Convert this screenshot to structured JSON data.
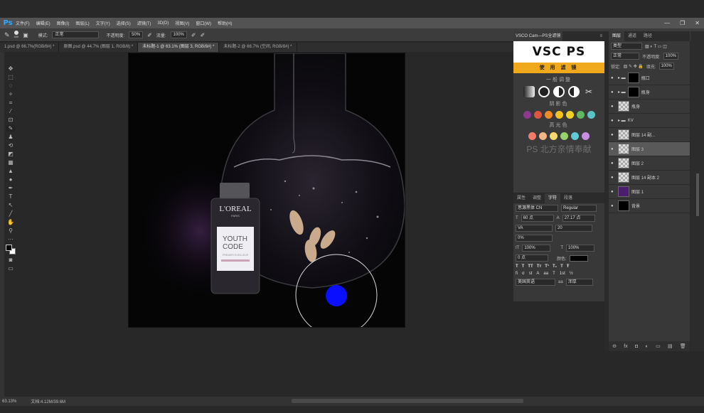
{
  "app": {
    "logo": "Ps",
    "menus": [
      "文件(F)",
      "编辑(E)",
      "图像(I)",
      "图层(L)",
      "文字(Y)",
      "选择(S)",
      "滤镜(T)",
      "3D(D)",
      "视图(V)",
      "窗口(W)",
      "帮助(H)"
    ],
    "window_controls": [
      "—",
      "❐",
      "✕"
    ]
  },
  "options": {
    "brush_size": "400",
    "mode_label": "模式:",
    "mode_value": "正常",
    "opacity_label": "不透明度:",
    "opacity_value": "50%",
    "flow_label": "流量:",
    "flow_value": "100%"
  },
  "tabs": [
    "1.psd @ 66.7%(RGB/8#) *",
    "原图.psd @ 44.7% (图层 1, RGB/8) *",
    "未标题-1 @ 63.1% (图层 3, RGB/8#) *",
    "未标题-2 @ 66.7% (空间, RGB/8#) *"
  ],
  "status": {
    "zoom": "63.13%",
    "doc": "文档:4.12M/39.6M"
  },
  "canvas": {
    "brand": "L'OREAL",
    "brand_sub": "PARIS",
    "product_line1": "YOUTH",
    "product_line2": "CODE",
    "product_sub": "PREMIER EVEILLEUR",
    "colors": {
      "brush_dot": "#0a10ff"
    }
  },
  "vsco": {
    "tab_title": "VSCO Cam—PS全滤镜",
    "logo": "VSC  PS",
    "band": "使 用 滤 镜",
    "sec_general": "一般调整",
    "sec_shadow": "阴影色",
    "sec_highlight": "高光色",
    "footer": "PS 北方亲情奉献",
    "shadow_colors": [
      "#8b3a8f",
      "#e0533c",
      "#f08a25",
      "#f5c21b",
      "#f2d02a",
      "#5fb85a",
      "#5ac4c4"
    ],
    "highlight_colors": [
      "#f27c6a",
      "#f5b486",
      "#f9d86b",
      "#96d46b",
      "#5fcbd6",
      "#c58ee0"
    ]
  },
  "character": {
    "tabs": [
      "属性",
      "调整",
      "字符",
      "段落"
    ],
    "font": "思源黑体 CN",
    "style": "Regular",
    "size": "60 点",
    "leading": "27.17 点",
    "kerning": "VA",
    "tracking": "20",
    "scale_pct": "0%",
    "vscale": "100%",
    "hscale": "100%",
    "baseline": "0 点",
    "color_label": "颜色:",
    "lang": "美国英语",
    "aa": "浑厚",
    "styles": [
      "T",
      "T",
      "TT",
      "Tт",
      "T¹",
      "T₁",
      "T",
      "Ŧ"
    ],
    "ot": [
      "fi",
      "σ",
      "st",
      "A",
      "aa",
      "T",
      "1st",
      "½"
    ]
  },
  "layers": {
    "tabs": [
      "图层",
      "通道",
      "路径"
    ],
    "kind": "类型",
    "blend": "正常",
    "opacity_label": "不透明度:",
    "opacity": "100%",
    "lock_label": "锁定:",
    "fill_label": "填充:",
    "fill": "100%",
    "rows": [
      {
        "name": "瓶口",
        "type": "group"
      },
      {
        "name": "瓶身",
        "type": "group"
      },
      {
        "name": "瓶身",
        "type": "layer"
      },
      {
        "name": "KV",
        "type": "group"
      },
      {
        "name": "图层 14 副...",
        "type": "layer"
      },
      {
        "name": "图层 3",
        "type": "layer",
        "selected": true
      },
      {
        "name": "图层 2",
        "type": "layer"
      },
      {
        "name": "图层 14 副本 2",
        "type": "layer"
      },
      {
        "name": "图层 1",
        "type": "layer"
      },
      {
        "name": "背景",
        "type": "layer"
      }
    ],
    "bottom_icons": [
      "⊖",
      "fx",
      "◘",
      "◐",
      "▭",
      "▤",
      "🗑"
    ]
  }
}
